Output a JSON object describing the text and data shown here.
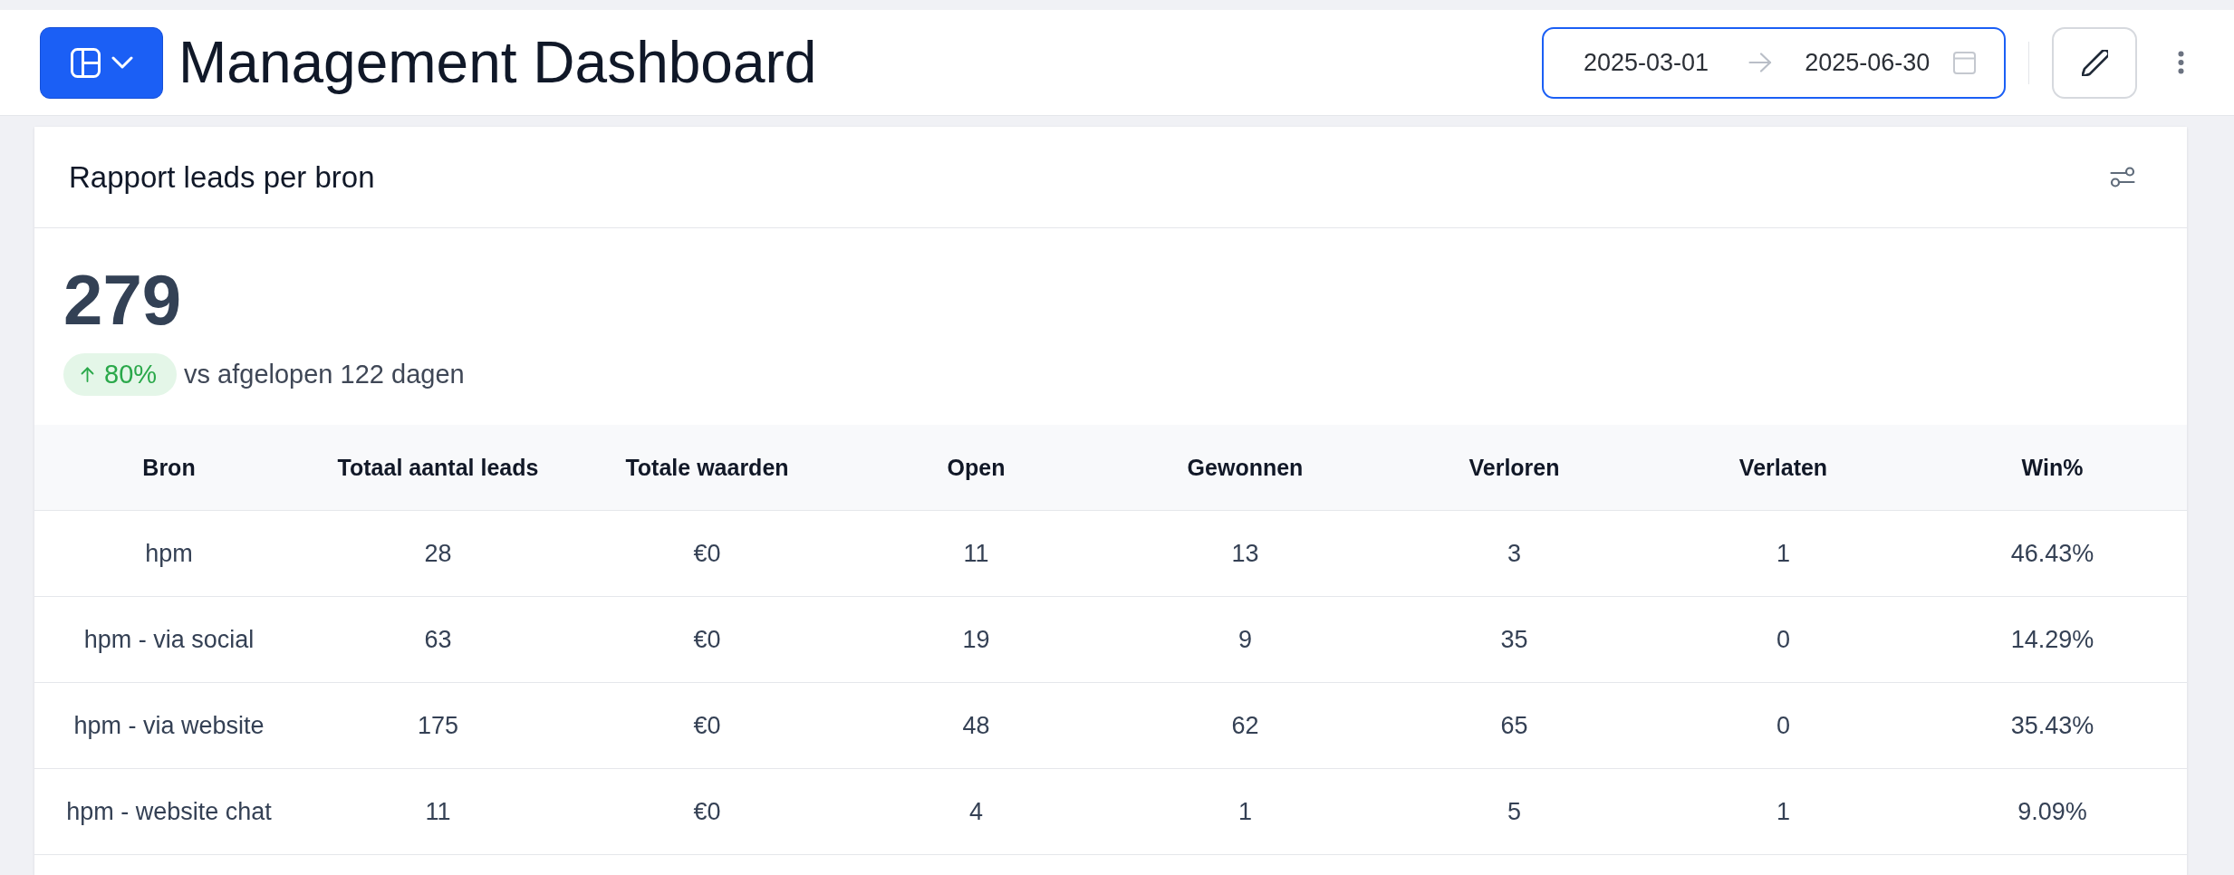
{
  "header": {
    "title": "Management Dashboard",
    "date_range": {
      "start": "2025-03-01",
      "end": "2025-06-30",
      "focused": true
    }
  },
  "card": {
    "title": "Rapport leads per bron",
    "kpi": {
      "value": "279",
      "change": {
        "positive": true,
        "text": "80%"
      },
      "comparison": "vs afgelopen 122 dagen"
    },
    "table": {
      "columns": [
        "Bron",
        "Totaal aantal leads",
        "Totale waarden",
        "Open",
        "Gewonnen",
        "Verloren",
        "Verlaten",
        "Win%"
      ],
      "rows": [
        [
          "hpm",
          "28",
          "€0",
          "11",
          "13",
          "3",
          "1",
          "46.43%"
        ],
        [
          "hpm - via social",
          "63",
          "€0",
          "19",
          "9",
          "35",
          "0",
          "14.29%"
        ],
        [
          "hpm - via website",
          "175",
          "€0",
          "48",
          "62",
          "65",
          "0",
          "35.43%"
        ],
        [
          "hpm - website chat",
          "11",
          "€0",
          "4",
          "1",
          "5",
          "1",
          "9.09%"
        ]
      ]
    }
  }
}
